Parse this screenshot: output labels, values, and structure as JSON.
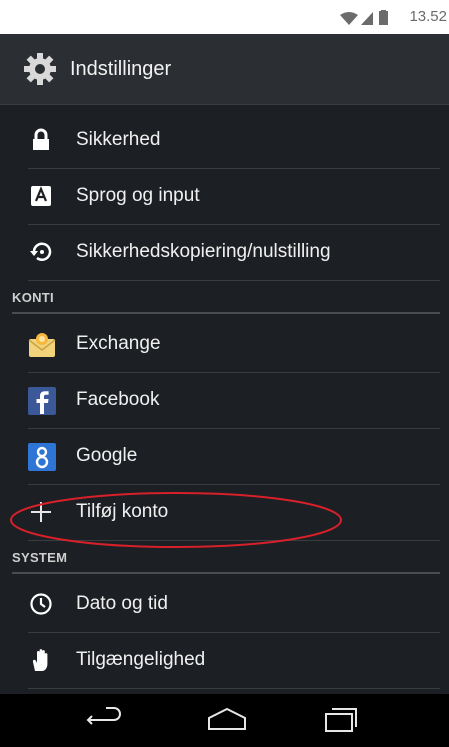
{
  "status_bar": {
    "time": "13.52",
    "icons": [
      "wifi-icon",
      "signal-icon",
      "battery-icon"
    ]
  },
  "action_bar": {
    "title": "Indstillinger",
    "icon": "gear-icon"
  },
  "items": [
    {
      "label": "Sikkerhed",
      "icon": "lock-icon"
    },
    {
      "label": "Sprog og input",
      "icon": "keyboard-icon"
    },
    {
      "label": "Sikkerhedskopiering/nulstilling",
      "icon": "backup-restore-icon"
    }
  ],
  "accounts_section": {
    "header": "KONTI",
    "items": [
      {
        "label": "Exchange",
        "icon": "exchange-mail-icon"
      },
      {
        "label": "Facebook",
        "icon": "facebook-icon"
      },
      {
        "label": "Google",
        "icon": "google-icon"
      },
      {
        "label": "Tilføj konto",
        "icon": "plus-icon"
      }
    ]
  },
  "system_section": {
    "header": "SYSTEM",
    "items": [
      {
        "label": "Dato og tid",
        "icon": "clock-icon"
      },
      {
        "label": "Tilgængelighed",
        "icon": "hand-icon"
      }
    ]
  },
  "nav_bar": {
    "buttons": [
      "back-icon",
      "home-icon",
      "recents-icon"
    ]
  },
  "colors": {
    "panel_background": "#1c1f23",
    "divider": "#3a3d40",
    "highlight_ellipse": "#d8202a",
    "facebook_blue": "#3b5998",
    "google_blue": "#2f75d6"
  }
}
